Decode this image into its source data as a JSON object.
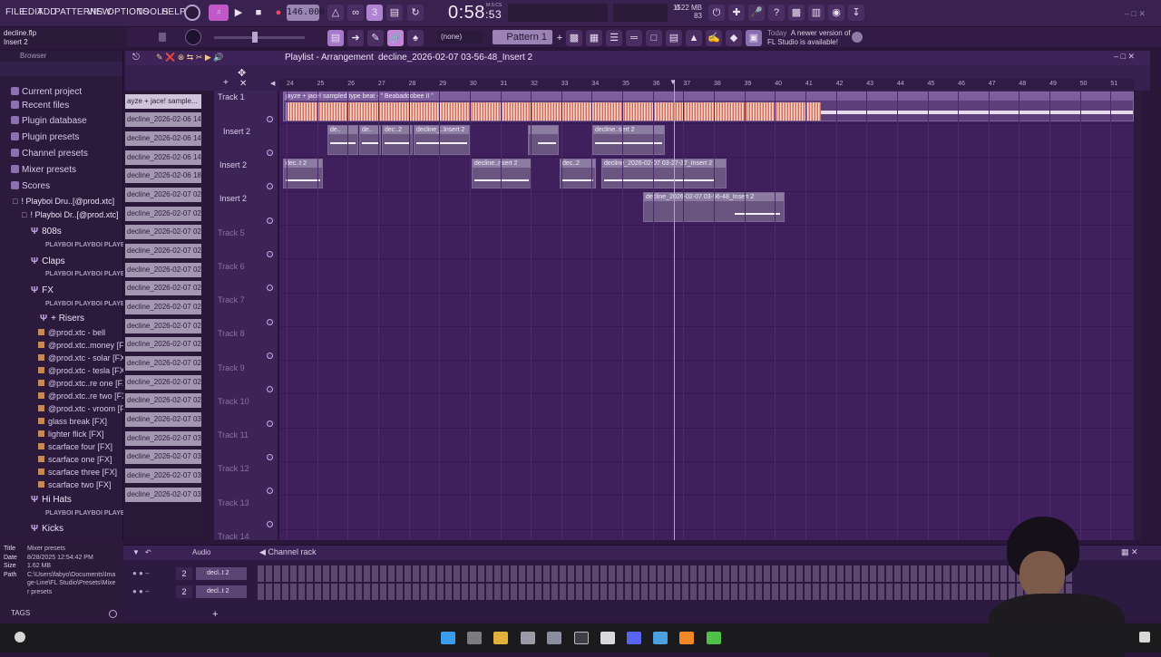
{
  "menu": [
    "FILE",
    "EDIT",
    "ADD",
    "PATTERNS",
    "VIEW",
    "OPTIONS",
    "TOOLS",
    "HELP"
  ],
  "transport": {
    "tempo": "146.000",
    "time_main": "0:58",
    "time_sub": ":53",
    "time_label": "M:S:CS"
  },
  "memory": {
    "top": "0",
    "mb": "1522 MB",
    "cpu": "83"
  },
  "hint": {
    "file": "decline.flp",
    "target": "Insert 2"
  },
  "pattern": {
    "label": "Pattern 1",
    "none_label": "(none)"
  },
  "news": {
    "day": "Today",
    "text1": "A newer version of",
    "text2": "FL Studio is available!"
  },
  "browser": {
    "title": "Browser",
    "items": [
      "Current project",
      "Recent files",
      "Plugin database",
      "Plugin presets",
      "Channel presets",
      "Mixer presets",
      "Scores"
    ],
    "tree1": "! Playboi Dru..[@prod.xtc]",
    "tree2": "! Playboi Dr..[@prod.xtc]",
    "folders": [
      "808s",
      "Claps",
      "FX",
      "+ Risers",
      "Hi Hats",
      "Kicks"
    ],
    "plogo": "PLAYBOI PLAYBOI PLAYBOI",
    "files": [
      "@prod.xtc - bell",
      "@prod.xtc..money [FX]",
      "@prod.xtc - solar [FX]",
      "@prod.xtc - tesla [FX]",
      "@prod.xtc..re one [FX]",
      "@prod.xtc..re two [FX]",
      "@prod.xtc - vroom [FX]",
      "glass break [FX]",
      "lighter flick [FX]",
      "scarface four [FX]",
      "scarface one [FX]",
      "scarface three [FX]",
      "scarface two [FX]"
    ]
  },
  "info": {
    "title_k": "Title",
    "title_v": "Mixer presets",
    "date_k": "Date",
    "date_v": "8/28/2025 12:54:42 PM",
    "size_k": "Size",
    "size_v": "1.62 MB",
    "path_k": "Path",
    "path_v": "C:\\Users\\fabyo\\Documents\\Image-Line\\FL Studio\\Presets\\Mixer presets",
    "tags": "TAGS"
  },
  "playlist": {
    "title": "Playlist - Arrangement",
    "arrangement": "decline_2026-02-07 03-56-48_Insert 2",
    "ruler": [
      "24",
      "25",
      "26",
      "27",
      "28",
      "29",
      "30",
      "31",
      "32",
      "33",
      "34",
      "35",
      "36",
      "37",
      "38",
      "39",
      "40",
      "41",
      "42",
      "43",
      "44",
      "45",
      "46",
      "47",
      "48",
      "49",
      "50",
      "51"
    ],
    "picker": [
      "ayze + jace! sample...",
      "decline_2026-02-06 14-...",
      "decline_2026-02-06 14-...",
      "decline_2026-02-06 14-...",
      "decline_2026-02-06 18-...",
      "decline_2026-02-07 02-...",
      "decline_2026-02-07 02-...",
      "decline_2026-02-07 02-...",
      "decline_2026-02-07 02-...",
      "decline_2026-02-07 02-...",
      "decline_2026-02-07 02-...",
      "decline_2026-02-07 02-...",
      "decline_2026-02-07 02-...",
      "decline_2026-02-07 02-...",
      "decline_2026-02-07 02-...",
      "decline_2026-02-07 02-...",
      "decline_2026-02-07 02-...",
      "decline_2026-02-07 03-...",
      "decline_2026-02-07 03-...",
      "decline_2026-02-07 03-...",
      "decline_2026-02-07 03-...",
      "decline_2026-02-07 03-..."
    ],
    "tracks": [
      "Track 1",
      "Insert 2",
      "Insert 2",
      "Insert 2",
      "Track 5",
      "Track 6",
      "Track 7",
      "Track 8",
      "Track 9",
      "Track 10",
      "Track 11",
      "Track 12",
      "Track 13",
      "Track 14"
    ],
    "clips": {
      "main": "jayze + jace! sampled type beat - \" Beabadoobee II \"",
      "c1": "de..",
      "c2": "de..",
      "c3": "dec..2",
      "c4": "decline_..Insert 2",
      "c5": "",
      "c6": "dec..2",
      "c7": "decline..sert 2",
      "t3a": "dec..t 2",
      "t3b": "decline..nsert 2",
      "t3c": "dec..2",
      "t3d": "decline_2026-02-07 03-27-37_Insert 2",
      "t4a": "decline_2026-02-07 03-56-48_Insert 2"
    }
  },
  "rack": {
    "audio_label": "Audio",
    "title": "Channel rack",
    "channels": [
      {
        "num": "2",
        "name": "decl..t 2"
      },
      {
        "num": "2",
        "name": "decl..t 2"
      }
    ]
  },
  "colors": {
    "accent": "#9b83b5",
    "background": "#3f1f5c",
    "waveform": "#f0a28c"
  }
}
